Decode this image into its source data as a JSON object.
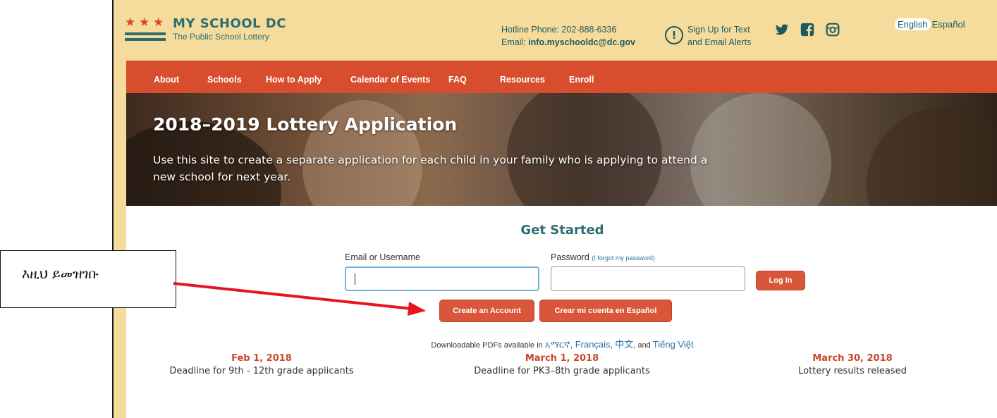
{
  "header": {
    "logo_title": "MY SCHOOL DC",
    "logo_subtitle": "The Public School Lottery",
    "hotline": "Hotline Phone: 202-888-6336",
    "email_prefix": "Email: ",
    "email_address": "info.myschooldc@dc.gov",
    "alert_line1": "Sign Up for Text",
    "alert_line2": "and Email Alerts",
    "alert_icon_glyph": "!",
    "social_icons": [
      "twitter-icon",
      "facebook-icon",
      "instagram-icon"
    ],
    "lang_en": "English",
    "lang_es": "Español"
  },
  "nav": {
    "items": [
      "About",
      "Schools",
      "How to Apply",
      "Calendar of Events",
      "FAQ",
      "Resources",
      "Enroll"
    ]
  },
  "hero": {
    "title": "2018–2019 Lottery Application",
    "subtitle": "Use this site to create a separate application for each child in your family who is applying to attend a new school for next year."
  },
  "login": {
    "heading": "Get Started",
    "email_label": "Email or Username",
    "email_value": "",
    "password_label": "Password",
    "forgot_link": "(I forgot my password)",
    "password_value": "",
    "login_button": "Log In",
    "create_button": "Create an Account",
    "crear_button": "Crear mi cuenta en Español"
  },
  "pdfs": {
    "prefix": "Downloadable PDFs available in ",
    "amharic": "አማርኛ",
    "french": "Français,",
    "chinese": "中文",
    "and": ", and ",
    "vietnamese": "Tiếng Việt"
  },
  "deadlines": [
    {
      "date": "Feb 1, 2018",
      "desc": "Deadline for 9th - 12th grade applicants"
    },
    {
      "date": "March 1, 2018",
      "desc": "Deadline for PK3–8th grade applicants"
    },
    {
      "date": "March 30, 2018",
      "desc": "Lottery results released"
    }
  ],
  "annotation": {
    "text": "እዚህ ይመዝገቡ"
  },
  "colors": {
    "accent_red": "#d94d2f",
    "brand_teal": "#2c6d72",
    "header_bg": "#f6dc9c"
  }
}
